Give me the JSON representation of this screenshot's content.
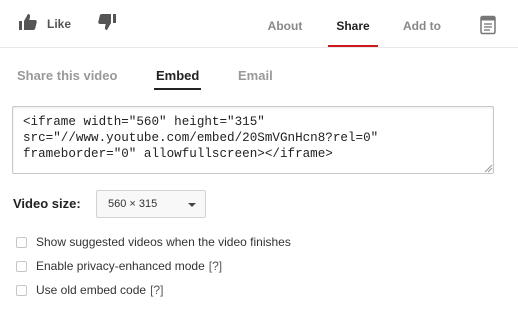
{
  "actions": {
    "like_label": "Like"
  },
  "tabs": [
    {
      "label": "About",
      "active": false
    },
    {
      "label": "Share",
      "active": true
    },
    {
      "label": "Add to",
      "active": false
    }
  ],
  "share_tabs": [
    {
      "label": "Share this video",
      "active": false
    },
    {
      "label": "Embed",
      "active": true
    },
    {
      "label": "Email",
      "active": false
    }
  ],
  "embed": {
    "code": "<iframe width=\"560\" height=\"315\"\nsrc=\"//www.youtube.com/embed/20SmVGnHcn8?rel=0\"\nframeborder=\"0\" allowfullscreen></iframe>"
  },
  "video_size": {
    "label": "Video size:",
    "selected": "560 × 315"
  },
  "options": [
    {
      "label": "Show suggested videos when the video finishes",
      "checked": false,
      "help": ""
    },
    {
      "label": "Enable privacy-enhanced mode",
      "checked": false,
      "help": "[?]"
    },
    {
      "label": "Use old embed code",
      "checked": false,
      "help": "[?]"
    }
  ],
  "colors": {
    "active_tab_underline": "#cc181e",
    "inactive_text": "#888888",
    "active_text": "#222222"
  },
  "icons": [
    "thumbs-up-icon",
    "thumbs-down-icon",
    "transcript-icon",
    "chevron-down-icon"
  ]
}
